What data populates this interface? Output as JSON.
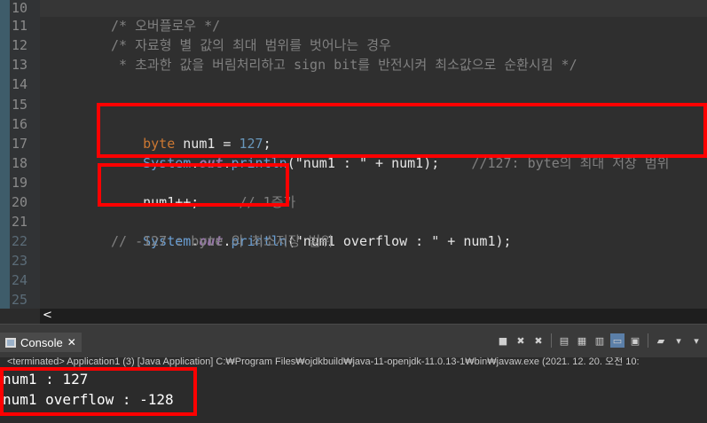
{
  "editor": {
    "line_numbers": [
      "10",
      "11",
      "12",
      "13",
      "14",
      "15",
      "16",
      "17",
      "18",
      "19",
      "20",
      "21",
      "22",
      "23",
      "24",
      "25"
    ],
    "lines": {
      "l11": "/* 오버플로우 */",
      "l12": "/* 자료형 별 값의 최대 범위를 벗어나는 경우",
      "l13": " * 초과한 값을 버림처리하고 sign bit를 반전시켜 최소값으로 순환시킴 */",
      "l16": {
        "kw": "byte",
        "var": " num1 = ",
        "num": "127",
        "end": ";"
      },
      "l17": {
        "cls": "System",
        "dot1": ".",
        "fld": "out",
        "dot2": ".",
        "mth": "println",
        "open": "(",
        "str": "\"num1 : \"",
        "rest": " + num1);",
        "cmt": "    //127: byte의 최대 저장 범위"
      },
      "l19": {
        "code": "num1++;",
        "cmt": "     // 1증가"
      },
      "l21": {
        "cls": "System",
        "dot1": ".",
        "fld": "out",
        "dot2": ".",
        "mth": "println",
        "open": "(",
        "str": "\"num1 overflow : \"",
        "rest": " + num1);"
      },
      "l22": "// -127 : byte 의 최소저장 범위"
    }
  },
  "hscroll": {
    "left_arrow": "<"
  },
  "console": {
    "tab_label": "Console",
    "close_glyph": "✕",
    "status": "<terminated> Application1 (3) [Java Application] C:₩Program Files₩ojdkbuild₩java-11-openjdk-11.0.13-1₩bin₩javaw.exe  (2021. 12. 20. 오전 10:",
    "output": [
      "num1 : 127",
      "num1 overflow : -128"
    ],
    "toolbar_icons": [
      "stop-icon",
      "remove-launch-icon",
      "remove-all-icon",
      "scroll-lock-icon",
      "word-wrap-icon",
      "show-stdout-icon",
      "show-stderr-icon",
      "pin-console-icon",
      "display-console-icon",
      "new-console-icon"
    ]
  },
  "colors": {
    "highlight_box": "#ff0000",
    "editor_bg": "#2f2f2f",
    "console_bg": "#2b2b2b"
  }
}
